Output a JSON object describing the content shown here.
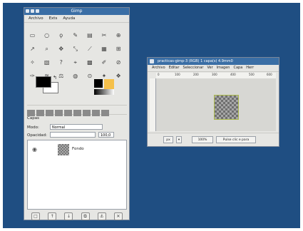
{
  "toolbox": {
    "title": "Gimp",
    "menu": [
      "Archivo",
      "Exts",
      "Ayuda"
    ],
    "tools": [
      "▭",
      "○",
      "ϙ",
      "✎",
      "▤",
      "✂",
      "⊕",
      "↗",
      "⌕",
      "✥",
      "⤡",
      "⟋",
      "▦",
      "⊞",
      "✧",
      "▧",
      "?",
      "⌖",
      "▩",
      "✐",
      "⊘",
      "✑",
      "≋",
      "⚖",
      "◍",
      "⊙",
      "✦",
      "❖"
    ],
    "mode_label": "Modo:",
    "mode_value": "Normal",
    "opacity_label": "Opacidad:",
    "opacity_value": "100,0",
    "layers_label": "Capas",
    "layer_name": "Fondo"
  },
  "image_window": {
    "title": "practicas-gimp-3 (RGB) 1 capa(s) 4.9mm0",
    "menu": [
      "Archivo",
      "Editar",
      "Seleccionar",
      "Ver",
      "Imagen",
      "Capa",
      "Herr"
    ],
    "ruler_marks": [
      "0",
      "100",
      "200",
      "300",
      "400",
      "500",
      "600"
    ],
    "unit": "px",
    "zoom": "100%",
    "status_text": "Pulse clic e para"
  }
}
